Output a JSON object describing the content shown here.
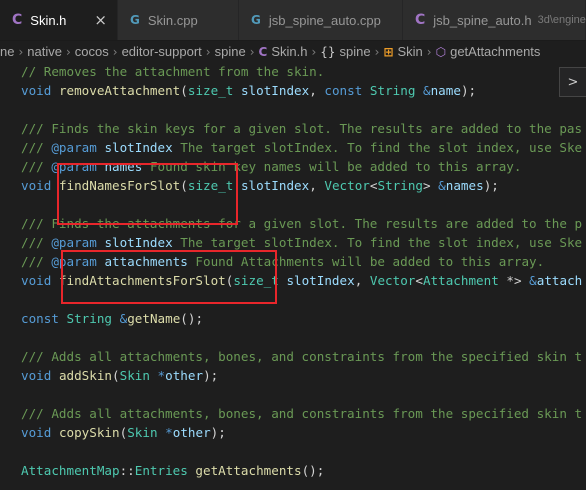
{
  "tabs": [
    {
      "icon": "C",
      "label": "Skin.h",
      "close": "×",
      "active": true
    },
    {
      "icon": "G",
      "label": "Skin.cpp",
      "active": false
    },
    {
      "icon": "G",
      "label": "jsb_spine_auto.cpp",
      "active": false
    },
    {
      "icon": "C",
      "label": "jsb_spine_auto.h",
      "description": "3d\\engine",
      "active": false
    }
  ],
  "breadcrumb": {
    "items": [
      "ne",
      "native",
      "cocos",
      "editor-support",
      "spine"
    ],
    "file": "Skin.h",
    "namespace_icon": "{}",
    "namespace": "spine",
    "class": "Skin",
    "function": "getAttachments"
  },
  "peek_icon": "chevron-right-icon",
  "peek_glyph": ">",
  "colors": {
    "editor_bg": "#1e1e1e",
    "comment": "#6a9955",
    "keyword": "#569cd6",
    "function": "#dcdcaa",
    "type": "#4ec9b0",
    "parameter": "#9cdcfe",
    "highlight_box": "#e8262b"
  },
  "code": {
    "l1": {
      "text": "// Removes the attachment from the skin."
    },
    "l2": {
      "kw": "void",
      "fn": "removeAttachment",
      "p": "(",
      "t": "size_t",
      "a": "slotIndex",
      "c": ",",
      "kw2": "const",
      "t2": "String",
      "amp": "&",
      "a2": "name",
      "end": ");"
    },
    "l4": {
      "text": "/// Finds the skin keys for a given slot. The results are added to the pas"
    },
    "l5": {
      "pre": "/// ",
      "tag": "@param",
      "name": "slotIndex",
      "rest": " The target slotIndex. To find the slot index, use Ske"
    },
    "l6": {
      "pre": "/// ",
      "tag": "@param",
      "name": "names",
      "rest": " Found skin key names will be added to this array."
    },
    "l7": {
      "kw": "void",
      "fn": "findNamesForSlot",
      "p": "(",
      "t": "size_t",
      "a": "slotIndex",
      "c": ",",
      "t2": "Vector",
      "lt": "<",
      "t3": "String",
      "gt": ">",
      "amp": "&",
      "a2": "names",
      "end": ");"
    },
    "l9": {
      "text": "/// Finds the attachments for a given slot. The results are added to the p"
    },
    "l10": {
      "pre": "/// ",
      "tag": "@param",
      "name": "slotIndex",
      "rest": " The target slotIndex. To find the slot index, use Ske"
    },
    "l11": {
      "pre": "/// ",
      "tag": "@param",
      "name": "attachments",
      "rest": " Found Attachments will be added to this array."
    },
    "l12": {
      "kw": "void",
      "fn": "findAttachmentsForSlot",
      "p": "(",
      "t": "size_t",
      "a": "slotIndex",
      "c": ",",
      "t2": "Vector",
      "lt": "<",
      "t3": "Attachment",
      "ptr": " *>",
      "amp": "&",
      "a2": "attach"
    },
    "l14": {
      "kw": "const",
      "t": "String",
      "amp": "&",
      "fn": "getName",
      "end": "();"
    },
    "l16": {
      "text": "/// Adds all attachments, bones, and constraints from the specified skin t"
    },
    "l17": {
      "kw": "void",
      "fn": "addSkin",
      "p": "(",
      "t": "Skin",
      "star": "*",
      "a": "other",
      "end": ");"
    },
    "l19": {
      "text": "/// Adds all attachments, bones, and constraints from the specified skin t"
    },
    "l20": {
      "kw": "void",
      "fn": "copySkin",
      "p": "(",
      "t": "Skin",
      "star": "*",
      "a": "other",
      "end": ");"
    },
    "l22": {
      "t": "AttachmentMap",
      "sep": "::",
      "t2": "Entries",
      "fn": "getAttachments",
      "end": "();"
    }
  }
}
